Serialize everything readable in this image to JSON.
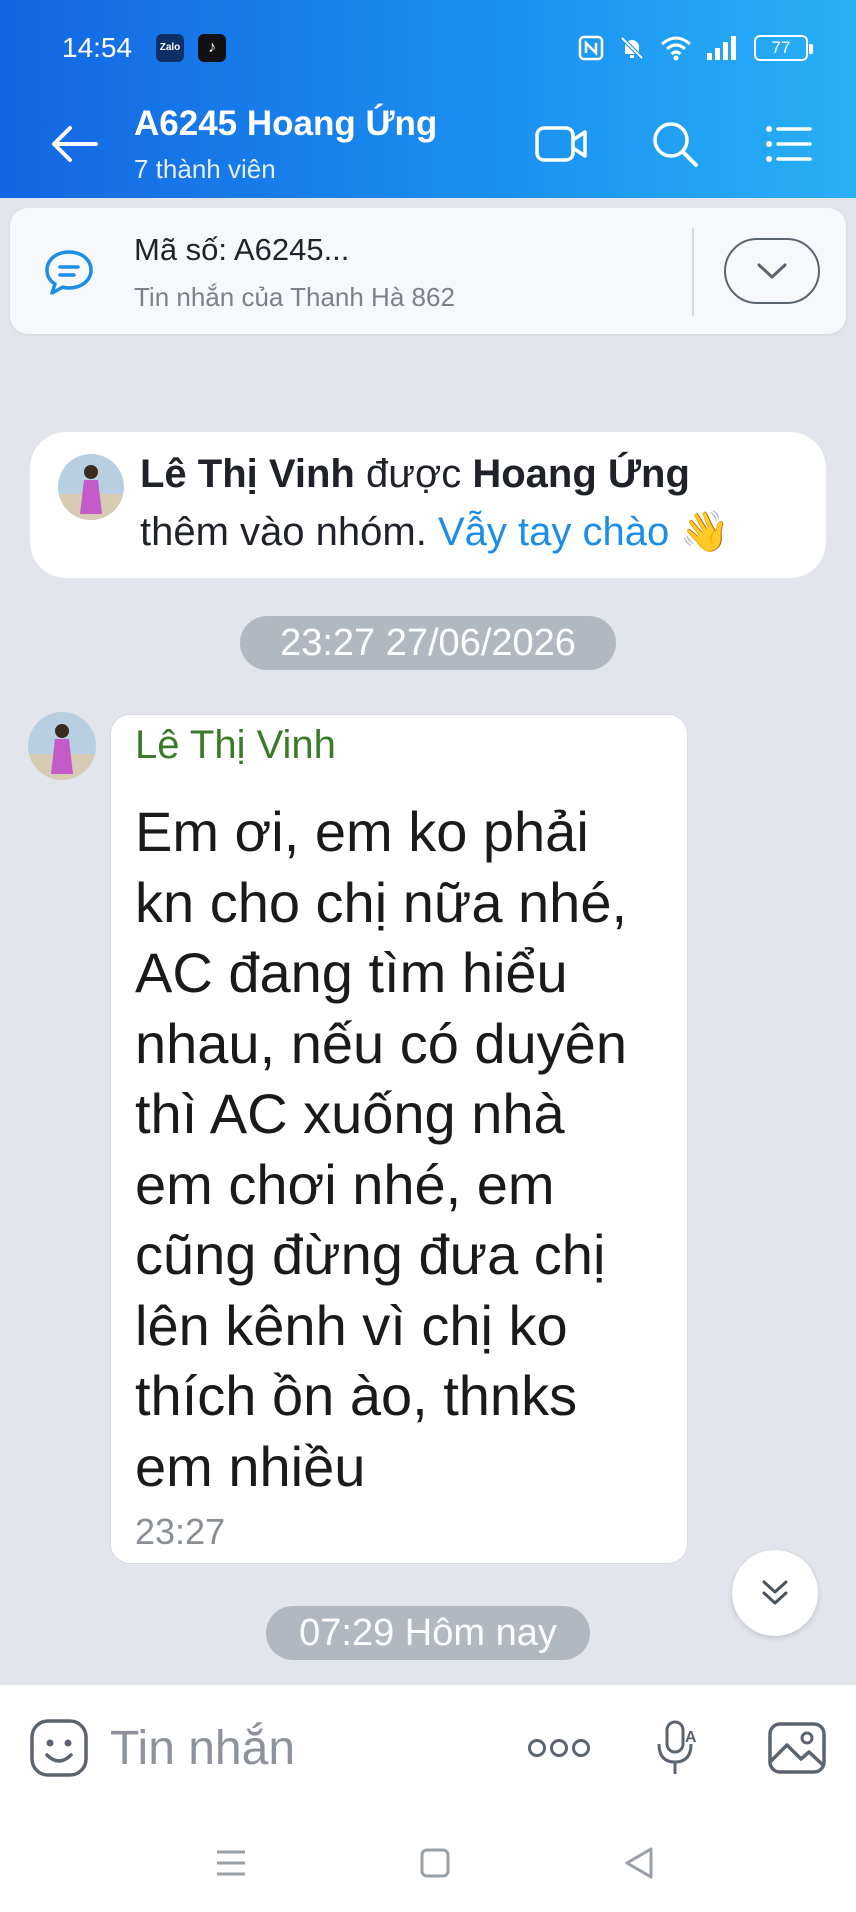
{
  "status_bar": {
    "time": "14:54",
    "app_icons": [
      "zalo-icon",
      "tiktok-icon"
    ],
    "mini_labels": [
      "Zalo",
      "♪"
    ],
    "battery": "77"
  },
  "header": {
    "title": "A6245 Hoang Ứng",
    "subtitle": "7 thành viên",
    "actions": [
      "video-call-icon",
      "search-icon",
      "menu-icon"
    ]
  },
  "pinned": {
    "title": "Mã số: A6245...",
    "subtitle": "Tin nhắn của Thanh Hà 862"
  },
  "system_message": {
    "name": "Lê Thị Vinh",
    "verb": " được ",
    "adder": "Hoang  Ứng",
    "rest": "thêm vào nhóm. ",
    "link": "Vẫy tay chào",
    "emoji": "👋"
  },
  "date_separator_1": "23:27 27/06/2026",
  "message": {
    "sender": "Lê Thị Vinh",
    "lines": [
      "Em ơi, em ko phải",
      "kn cho chị nữa nhé,",
      "AC đang tìm hiểu",
      "nhau, nếu có duyên",
      "thì AC xuống nhà",
      "em chơi nhé, em",
      "cũng đừng đưa chị",
      "lên kênh vì chị ko",
      "thích ồn ào, thnks",
      "em nhiều"
    ],
    "time": "23:27"
  },
  "date_separator_2": "07:29 Hôm nay",
  "composer": {
    "placeholder": "Tin nhắn"
  },
  "colors": {
    "header_start": "#1466e2",
    "header_end": "#28b0f5",
    "link": "#1d8ee8",
    "sender_name": "#3b7a28",
    "background": "#e2e6ec"
  }
}
